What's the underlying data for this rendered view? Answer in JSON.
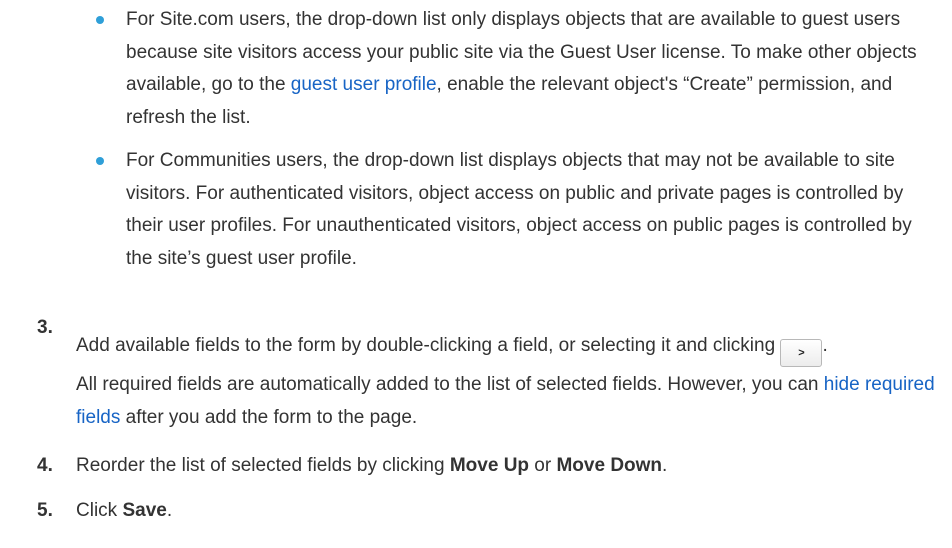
{
  "bullets": [
    {
      "text_before": "For Site.com users, the drop-down list only displays objects that are available to guest users because site visitors access your public site via the Guest User license. To make other objects available, go to the ",
      "link": "guest user profile",
      "text_after": ", enable the relevant object's “Create” permission, and refresh the list."
    },
    {
      "text": "For Communities users, the drop-down list displays objects that may not be available to site visitors. For authenticated visitors, object access on public and private pages is controlled by their user profiles. For unauthenticated visitors, object access on public pages is controlled by the site’s guest user profile."
    }
  ],
  "step3": {
    "number": "3.",
    "line1": "Add available fields to the form by double-clicking a field, or selecting it and clicking",
    "button_label": ">",
    "line1_end": ".",
    "note_before": "All required fields are automatically added to the list of selected fields. However, you can ",
    "note_link": "hide required fields",
    "note_after": " after you add the form to the page."
  },
  "step4": {
    "number": "4.",
    "text_before": "Reorder the list of selected fields by clicking ",
    "bold1": "Move Up",
    "text_mid": " or ",
    "bold2": "Move Down",
    "text_after": "."
  },
  "step5": {
    "number": "5.",
    "text_before": "Click ",
    "bold": "Save",
    "text_after": "."
  }
}
